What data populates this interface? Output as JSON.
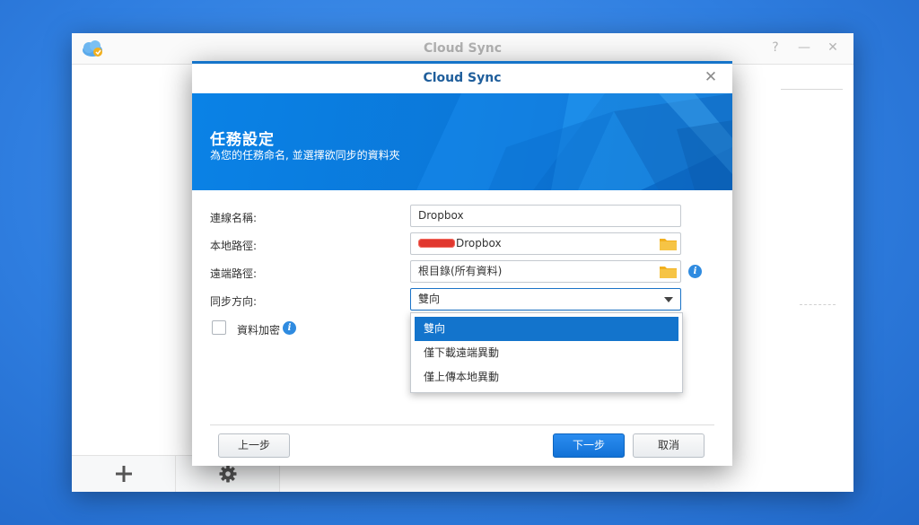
{
  "app": {
    "title": "Cloud Sync",
    "controls": {
      "help": "?",
      "minimize": "—",
      "close": "✕"
    }
  },
  "sidebar": {
    "footer": {
      "add_icon": "plus-icon",
      "settings_icon": "gear-icon"
    }
  },
  "dialog": {
    "title": "Cloud Sync",
    "close": "✕",
    "banner": {
      "title": "任務設定",
      "subtitle": "為您的任務命名, 並選擇欲同步的資料夾"
    },
    "form": {
      "connection_name_label": "連線名稱:",
      "connection_name_value": "Dropbox",
      "local_path_label": "本地路徑:",
      "local_path_value": "Dropbox",
      "remote_path_label": "遠端路徑:",
      "remote_path_value": "根目錄(所有資料)",
      "sync_direction_label": "同步方向:",
      "sync_direction_value": "雙向",
      "encryption_label": "資料加密",
      "encryption_checked": false
    },
    "dropdown": {
      "options": [
        "雙向",
        "僅下載遠端異動",
        "僅上傳本地異動"
      ],
      "selected_index": 0
    },
    "buttons": {
      "back": "上一步",
      "next": "下一步",
      "cancel": "取消"
    }
  },
  "colors": {
    "accent": "#1374cc",
    "banner": "#0b77d8",
    "desktop": "#2f7ee0",
    "folder": "#f2b01e"
  }
}
